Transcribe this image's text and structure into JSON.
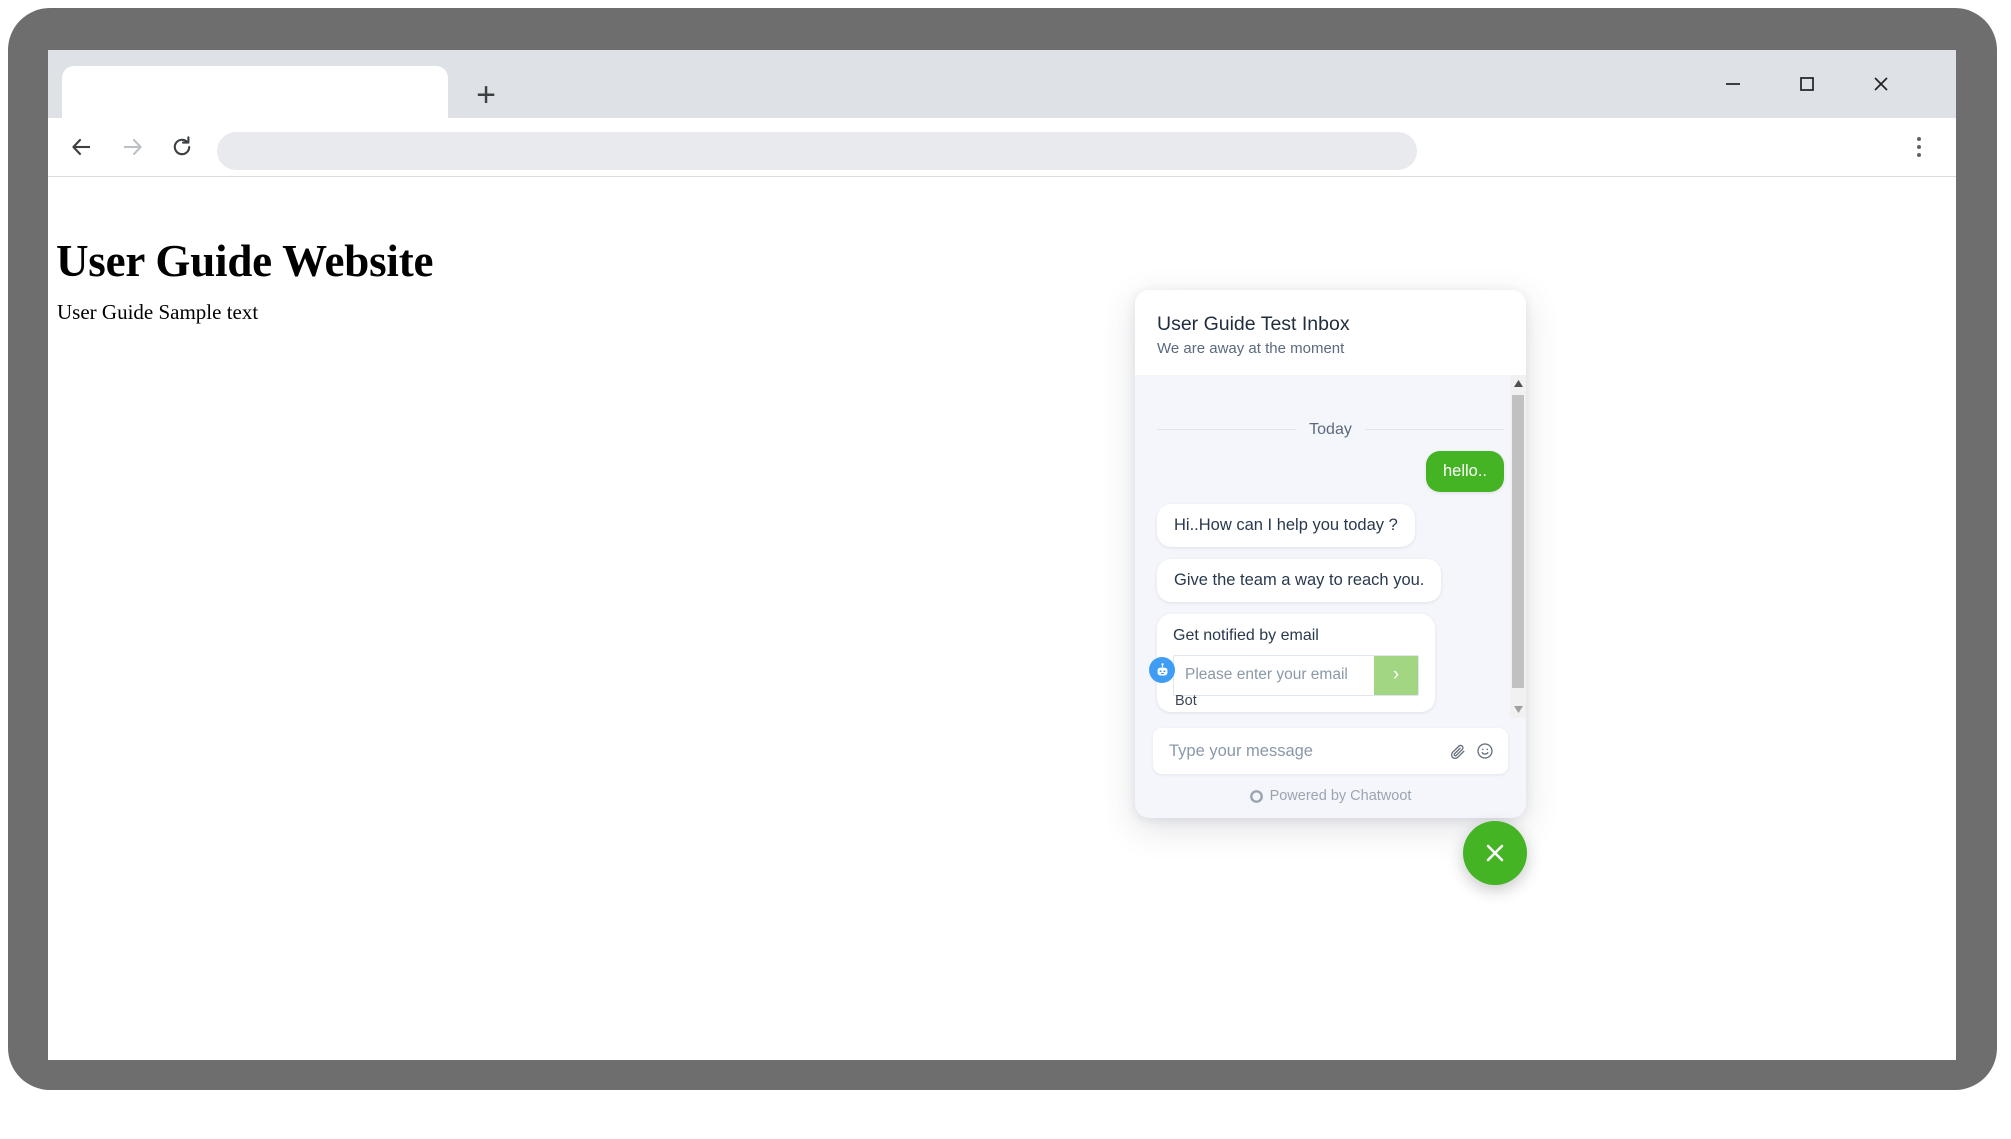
{
  "browser": {
    "tab_title": "",
    "new_tab_label": "+",
    "window_controls": {
      "minimize": "—",
      "maximize": "□",
      "close": "✕"
    },
    "toolbar": {
      "back_label": "Back",
      "forward_label": "Forward",
      "reload_label": "Reload",
      "menu_label": "Customize and control",
      "address_value": "",
      "address_placeholder": ""
    }
  },
  "page": {
    "title": "User Guide Website",
    "paragraph": "User Guide Sample text"
  },
  "chat": {
    "header": {
      "title": "User Guide Test Inbox",
      "subtitle": "We are away at the moment"
    },
    "date_divider": "Today",
    "messages": [
      {
        "sender": "user",
        "text": "hello.."
      },
      {
        "sender": "bot",
        "text": "Hi..How can I help you today ?"
      },
      {
        "sender": "bot",
        "text": "Give the team a way to reach you."
      }
    ],
    "email_form": {
      "label": "Get notified by email",
      "input_value": "",
      "input_placeholder": "Please enter your email",
      "submit_label": "›"
    },
    "bot_sender_name": "Bot",
    "composer": {
      "input_value": "",
      "input_placeholder": "Type your message",
      "attachment_icon": "paperclip-icon",
      "emoji_icon": "smiley-icon"
    },
    "footer_text": "Powered by Chatwoot",
    "toggle_button_label": "✕",
    "colors": {
      "user_bubble": "#44b324",
      "toggle_button": "#44b324",
      "email_submit": "#a2d683",
      "bot_avatar": "#3f9df5"
    }
  }
}
